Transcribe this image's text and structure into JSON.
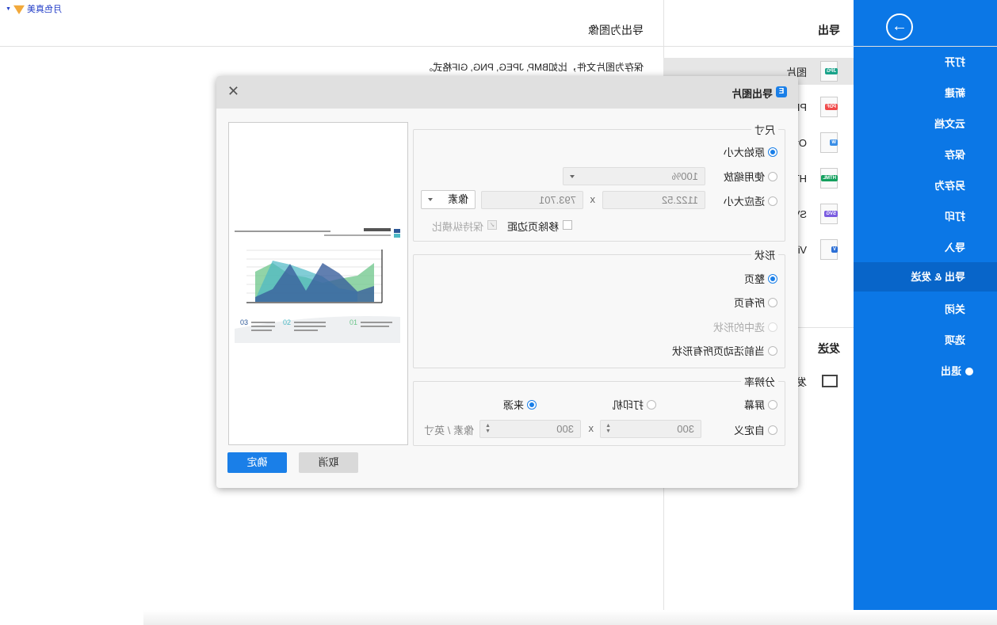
{
  "user": {
    "name": "月色真美"
  },
  "sidebar": {
    "items": [
      {
        "label": "打开"
      },
      {
        "label": "新建"
      },
      {
        "label": "云文档"
      },
      {
        "label": "保存"
      },
      {
        "label": "另存为"
      },
      {
        "label": "打印"
      },
      {
        "label": "导入"
      },
      {
        "label": "导出 & 发送",
        "active": true
      },
      {
        "label": "关闭"
      },
      {
        "label": "选项"
      },
      {
        "label": "退出"
      }
    ],
    "accent": "#0b77e6"
  },
  "export_panel": {
    "header": "导出",
    "items": [
      {
        "label": "图片",
        "badge": "JPG",
        "color": "#1aa38a"
      },
      {
        "label": "PDF",
        "badge": "PDF",
        "color": "#f04a4a"
      },
      {
        "label": "Office",
        "badge": "W",
        "color": "#3a8ee6"
      },
      {
        "label": "HTML",
        "badge": "HTML",
        "color": "#14a05e"
      },
      {
        "label": "SVG",
        "badge": "SVG",
        "color": "#7a5ce0"
      },
      {
        "label": "Visio",
        "badge": "V",
        "color": "#2c6fd6"
      }
    ],
    "send_header": "发送",
    "send_item": "发送邮件"
  },
  "content": {
    "title": "导出为图像",
    "description": "保存为图片文件，比如BMP, JPEG, PNG, GIF格式。"
  },
  "dialog": {
    "title": "导出图片",
    "size": {
      "legend": "尺寸",
      "options": [
        "原始大小",
        "使用缩放",
        "适应大小"
      ],
      "selected": "原始大小",
      "zoom": "100%",
      "width": "1122.52",
      "x": "x",
      "height": "793.701",
      "unit": "像素",
      "remove_margin": "移除页边距",
      "keep_ratio": "保持纵横比"
    },
    "shape": {
      "legend": "形状",
      "options": [
        "整页",
        "所有页",
        "选中的形状",
        "当前活动页所有形状"
      ],
      "selected": "整页"
    },
    "resolution": {
      "legend": "分辨率",
      "options": [
        "屏幕",
        "打印机",
        "来源"
      ],
      "selected": "来源",
      "custom": "自定义",
      "w": "300",
      "x": "x",
      "h": "300",
      "unit": "像素 / 英寸"
    },
    "ok": "确定",
    "cancel": "取消"
  }
}
